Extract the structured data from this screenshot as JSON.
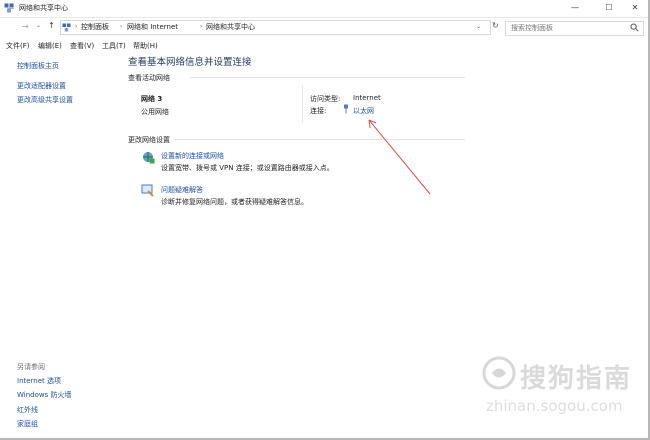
{
  "window": {
    "title": "网络和共享中心",
    "minimize_glyph": "—",
    "maximize_glyph": "☐",
    "close_glyph": "✕"
  },
  "nav": {
    "back_glyph": "←",
    "forward_glyph": "→",
    "recent_glyph": "⌄",
    "up_glyph": "↑",
    "breadcrumbs": [
      "控制面板",
      "网络和 Internet",
      "网络和共享中心"
    ],
    "separator_glyph": "›",
    "dropdown_glyph": "⌄",
    "refresh_glyph": "↻"
  },
  "search": {
    "placeholder": "搜索控制面板",
    "icon": "search-icon"
  },
  "menu": [
    "文件(F)",
    "编辑(E)",
    "查看(V)",
    "工具(T)",
    "帮助(H)"
  ],
  "left_pane": {
    "items": [
      "控制面板主页",
      "更改适配器设置",
      "更改高级共享设置"
    ],
    "see_also_title": "另请参阅",
    "see_also": [
      "Internet 选项",
      "Windows 防火墙",
      "红外线",
      "家庭组"
    ]
  },
  "main": {
    "title": "查看基本网络信息并设置连接",
    "active_networks_header": "查看活动网络",
    "network_name": "网络  3",
    "network_type": "公用网络",
    "access_type_label": "访问类型:",
    "access_type_value": "Internet",
    "connections_label": "连接:",
    "connections_value": "以太网",
    "change_settings_header": "更改网络设置",
    "tasks": [
      {
        "link": "设置新的连接或网络",
        "desc": "设置宽带、拨号或 VPN 连接；或设置路由器或接入点。",
        "icon": "new-connection-icon"
      },
      {
        "link": "问题疑难解答",
        "desc": "诊断并修复网络问题，或者获得疑难解答信息。",
        "icon": "troubleshoot-icon"
      }
    ]
  },
  "watermark": {
    "text": "搜狗指南",
    "url": "zhinan.sogou.com"
  },
  "colors": {
    "link": "#1b4f9c",
    "title": "#1e395b",
    "annotation_arrow": "#d9534f"
  }
}
